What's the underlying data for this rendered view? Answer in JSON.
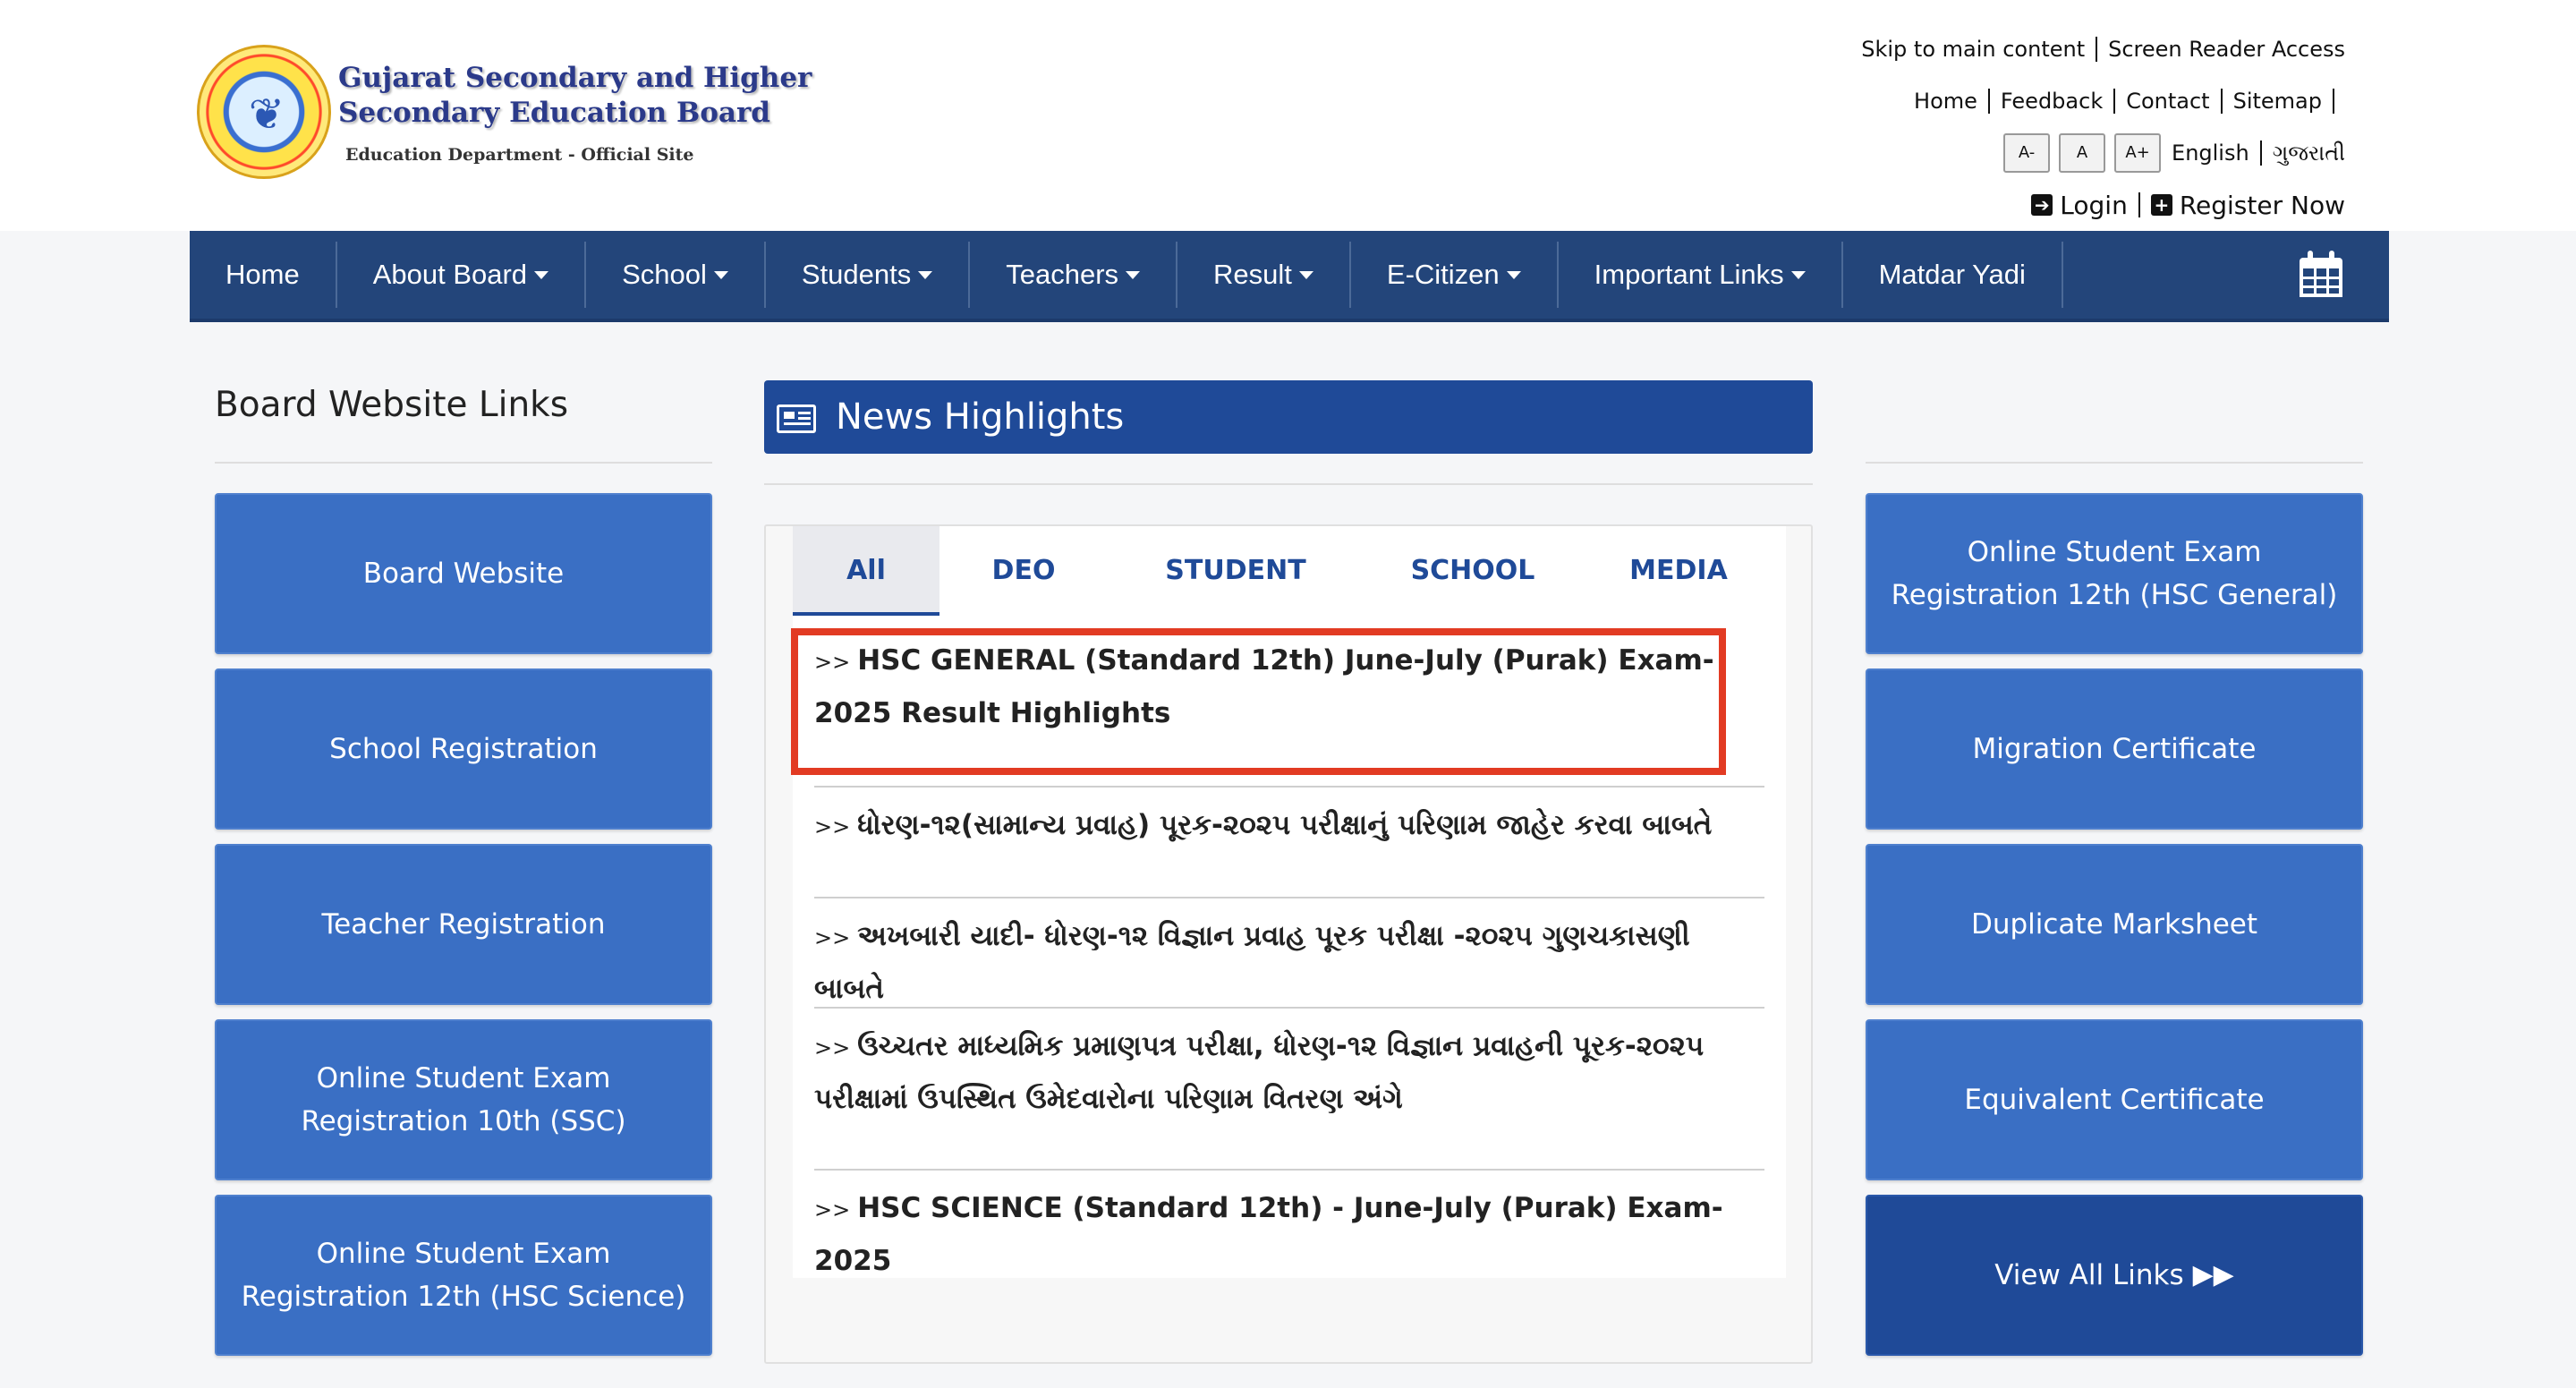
{
  "header": {
    "board_name_line1": "Gujarat Secondary and Higher",
    "board_name_line2": "Secondary Education Board",
    "board_sub": "Education Department - Official Site",
    "logo_icon": "board-seal-logo"
  },
  "top_links": {
    "skip": "Skip to main content",
    "screen_reader": "Screen Reader Access",
    "home": "Home",
    "feedback": "Feedback",
    "contact": "Contact",
    "sitemap": "Sitemap",
    "font_small": "A-",
    "font_normal": "A",
    "font_large": "A+",
    "lang_en": "English",
    "lang_gu": "ગુજરાતી",
    "login": "Login",
    "register": "Register Now"
  },
  "nav": {
    "items": [
      {
        "label": "Home",
        "dropdown": false
      },
      {
        "label": "About Board",
        "dropdown": true
      },
      {
        "label": "School",
        "dropdown": true
      },
      {
        "label": "Students",
        "dropdown": true
      },
      {
        "label": "Teachers",
        "dropdown": true
      },
      {
        "label": "Result",
        "dropdown": true
      },
      {
        "label": "E-Citizen",
        "dropdown": true
      },
      {
        "label": "Important Links",
        "dropdown": true
      },
      {
        "label": "Matdar Yadi",
        "dropdown": false
      }
    ],
    "calendar_icon": "calendar-icon"
  },
  "left": {
    "title": "Board Website Links",
    "tiles": [
      "Board Website",
      "School Registration",
      "Teacher Registration",
      "Online Student Exam Registration 10th (SSC)",
      "Online Student Exam Registration 12th (HSC Science)"
    ]
  },
  "news": {
    "title": "News Highlights",
    "tabs": [
      "All",
      "DEO",
      "STUDENT",
      "SCHOOL",
      "MEDIA"
    ],
    "active_tab": "All",
    "prefix": ">>",
    "items": [
      "HSC GENERAL (Standard 12th) June-July (Purak) Exam-2025 Result Highlights",
      "ધોરણ-૧૨(સામાન્ય પ્રવાહ) પૂરક-૨૦૨૫ પરીક્ષાનું પરિણામ જાહેર કરવા બાબતે",
      "અખબારી યાદી- ધોરણ-૧૨ વિજ્ઞાન પ્રવાહ પૂરક પરીક્ષા -૨૦૨૫ ગુણચકાસણી બાબતે",
      "ઉચ્ચતર માધ્યમિક પ્રમાણપત્ર પરીક્ષા, ધોરણ-૧૨ વિજ્ઞાન પ્રવાહની પૂરક-૨૦૨૫ પરીક્ષામાં ઉપસ્થિત ઉમેદવારોના પરિણામ વિતરણ અંગે",
      "HSC SCIENCE (Standard 12th) - June-July (Purak) Exam-2025"
    ],
    "highlight_color": "#e23b23"
  },
  "right": {
    "tiles": [
      "Online Student Exam Registration 12th (HSC General)",
      "Migration Certificate",
      "Duplicate Marksheet",
      "Equivalent Certificate"
    ],
    "view_all": "View All Links"
  },
  "colors": {
    "nav_bg": "#23457a",
    "tile_bg": "#3a6fc4",
    "tile_dark": "#1f4a98",
    "accent": "#1f4a98"
  }
}
